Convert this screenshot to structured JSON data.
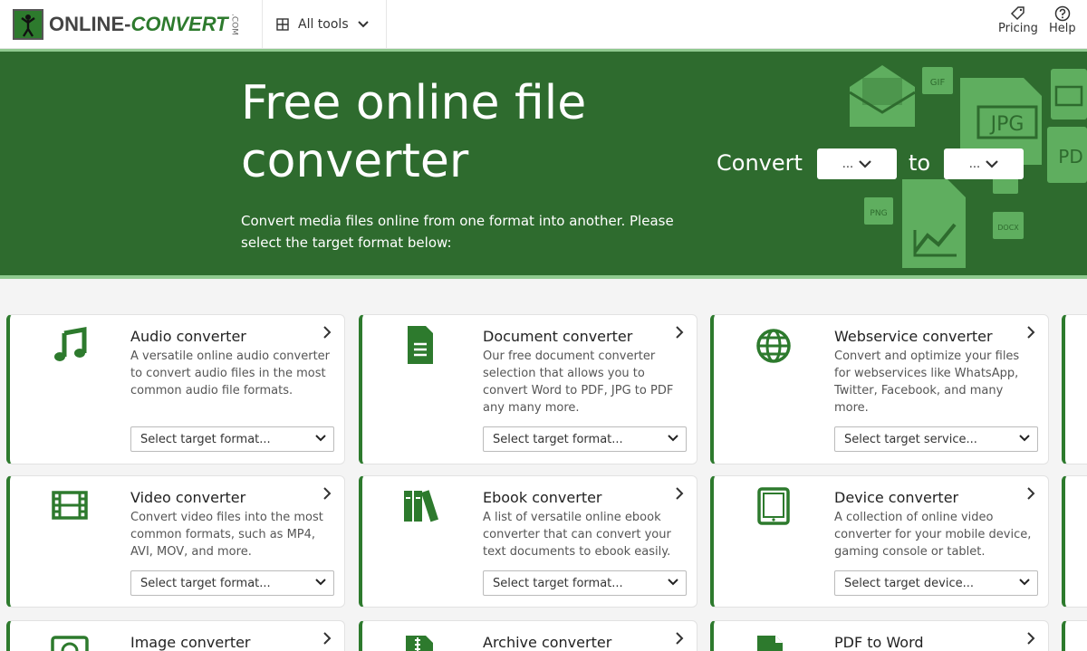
{
  "header": {
    "logo_main": "ONLINE-",
    "logo_accent": "CONVERT",
    "logo_suffix": ".COM",
    "all_tools": "All tools",
    "pricing": "Pricing",
    "help": "Help"
  },
  "hero": {
    "title": "Free online file converter",
    "subtitle": "Convert media files online from one format into another. Please select the target format below:",
    "convert_label": "Convert",
    "to_label": "to",
    "from_value": "...",
    "to_value": "...",
    "deco_labels": [
      "GIF",
      "JPG",
      "PNG",
      "DOCX",
      "PD"
    ]
  },
  "cards": [
    {
      "title": "Audio converter",
      "desc": "A versatile online audio converter to convert audio files in the most common audio file formats.",
      "select": "Select target format...",
      "icon": "music-note-icon"
    },
    {
      "title": "Document converter",
      "desc": "Our free document converter selection that allows you to convert Word to PDF, JPG to PDF any many more.",
      "select": "Select target format...",
      "icon": "document-icon"
    },
    {
      "title": "Webservice converter",
      "desc": "Convert and optimize your files for webservices like WhatsApp, Twitter, Facebook, and many more.",
      "select": "Select target service...",
      "icon": "globe-icon"
    },
    {
      "title": "Video converter",
      "desc": "Convert video files into the most common formats, such as MP4, AVI, MOV, and more.",
      "select": "Select target format...",
      "icon": "film-icon"
    },
    {
      "title": "Ebook converter",
      "desc": "A list of versatile online ebook converter that can convert your text documents to ebook easily.",
      "select": "Select target format...",
      "icon": "books-icon"
    },
    {
      "title": "Device converter",
      "desc": "A collection of online video converter for your mobile device, gaming console or tablet.",
      "select": "Select target device...",
      "icon": "tablet-icon"
    },
    {
      "title": "Image converter",
      "icon": "camera-icon"
    },
    {
      "title": "Archive converter",
      "icon": "archive-icon"
    },
    {
      "title": "PDF to Word",
      "icon": "pdf-icon"
    }
  ],
  "colors": {
    "brand": "#2d7a2d",
    "hero_bg": "#2e6b2e",
    "accent_light": "#8fc98f"
  }
}
